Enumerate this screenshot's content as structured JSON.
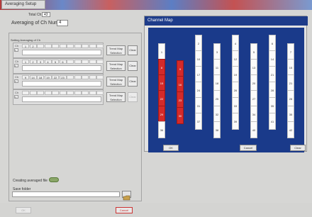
{
  "window": {
    "title": "Averaging Setup"
  },
  "total_ch": {
    "label": "Total Ch",
    "value": "43"
  },
  "averaging": {
    "label": "Averaging of Ch Num",
    "value": "4"
  },
  "setting_title": "Setting Averaging of Ch",
  "rows": [
    {
      "label": "Ch",
      "index": "1",
      "cells": [
        "1",
        "2",
        "",
        "",
        "",
        "",
        "",
        "",
        "",
        "",
        ""
      ]
    },
    {
      "label": "Ch",
      "index": "2",
      "cells": [
        "1",
        "2",
        "3",
        "4",
        "5",
        "6",
        "",
        "",
        "",
        "",
        ""
      ]
    },
    {
      "label": "Ch",
      "index": "3",
      "cells": [
        "9",
        "14",
        "18",
        "19",
        "22",
        "23",
        "",
        "",
        "",
        "",
        ""
      ]
    },
    {
      "label": "Ch",
      "index": "4",
      "cells": [
        "",
        "",
        "",
        "",
        "",
        "",
        "",
        "",
        "",
        "",
        ""
      ]
    }
  ],
  "buttons": {
    "trend_map": "Trend Map Selection",
    "clear": "Clear",
    "cancel": "Cancel",
    "ok": "OK"
  },
  "creating_file": "Creating averaged file",
  "save_folder": "Save folder",
  "channel_map": {
    "title": "Channel Map",
    "columns": [
      [
        "1",
        "8",
        "15",
        "22",
        "29",
        "36"
      ],
      [
        "9",
        "16",
        "23",
        "30"
      ],
      [
        "2",
        "10",
        "17",
        "24",
        "31",
        "37"
      ],
      [
        "3",
        "11",
        "18",
        "25",
        "32",
        "38"
      ],
      [
        "4",
        "12",
        "19",
        "26",
        "33",
        "39"
      ],
      [
        "5",
        "13",
        "20",
        "27",
        "34",
        "40"
      ],
      [
        "6",
        "14",
        "21",
        "28",
        "35",
        "41"
      ],
      [
        "7",
        "15",
        "21",
        "28",
        "35",
        "42"
      ]
    ],
    "selected": [
      "8",
      "9",
      "15",
      "16",
      "22",
      "23",
      "29",
      "30"
    ],
    "ok": "OK",
    "cancel": "Cancel",
    "clear": "Clear"
  }
}
